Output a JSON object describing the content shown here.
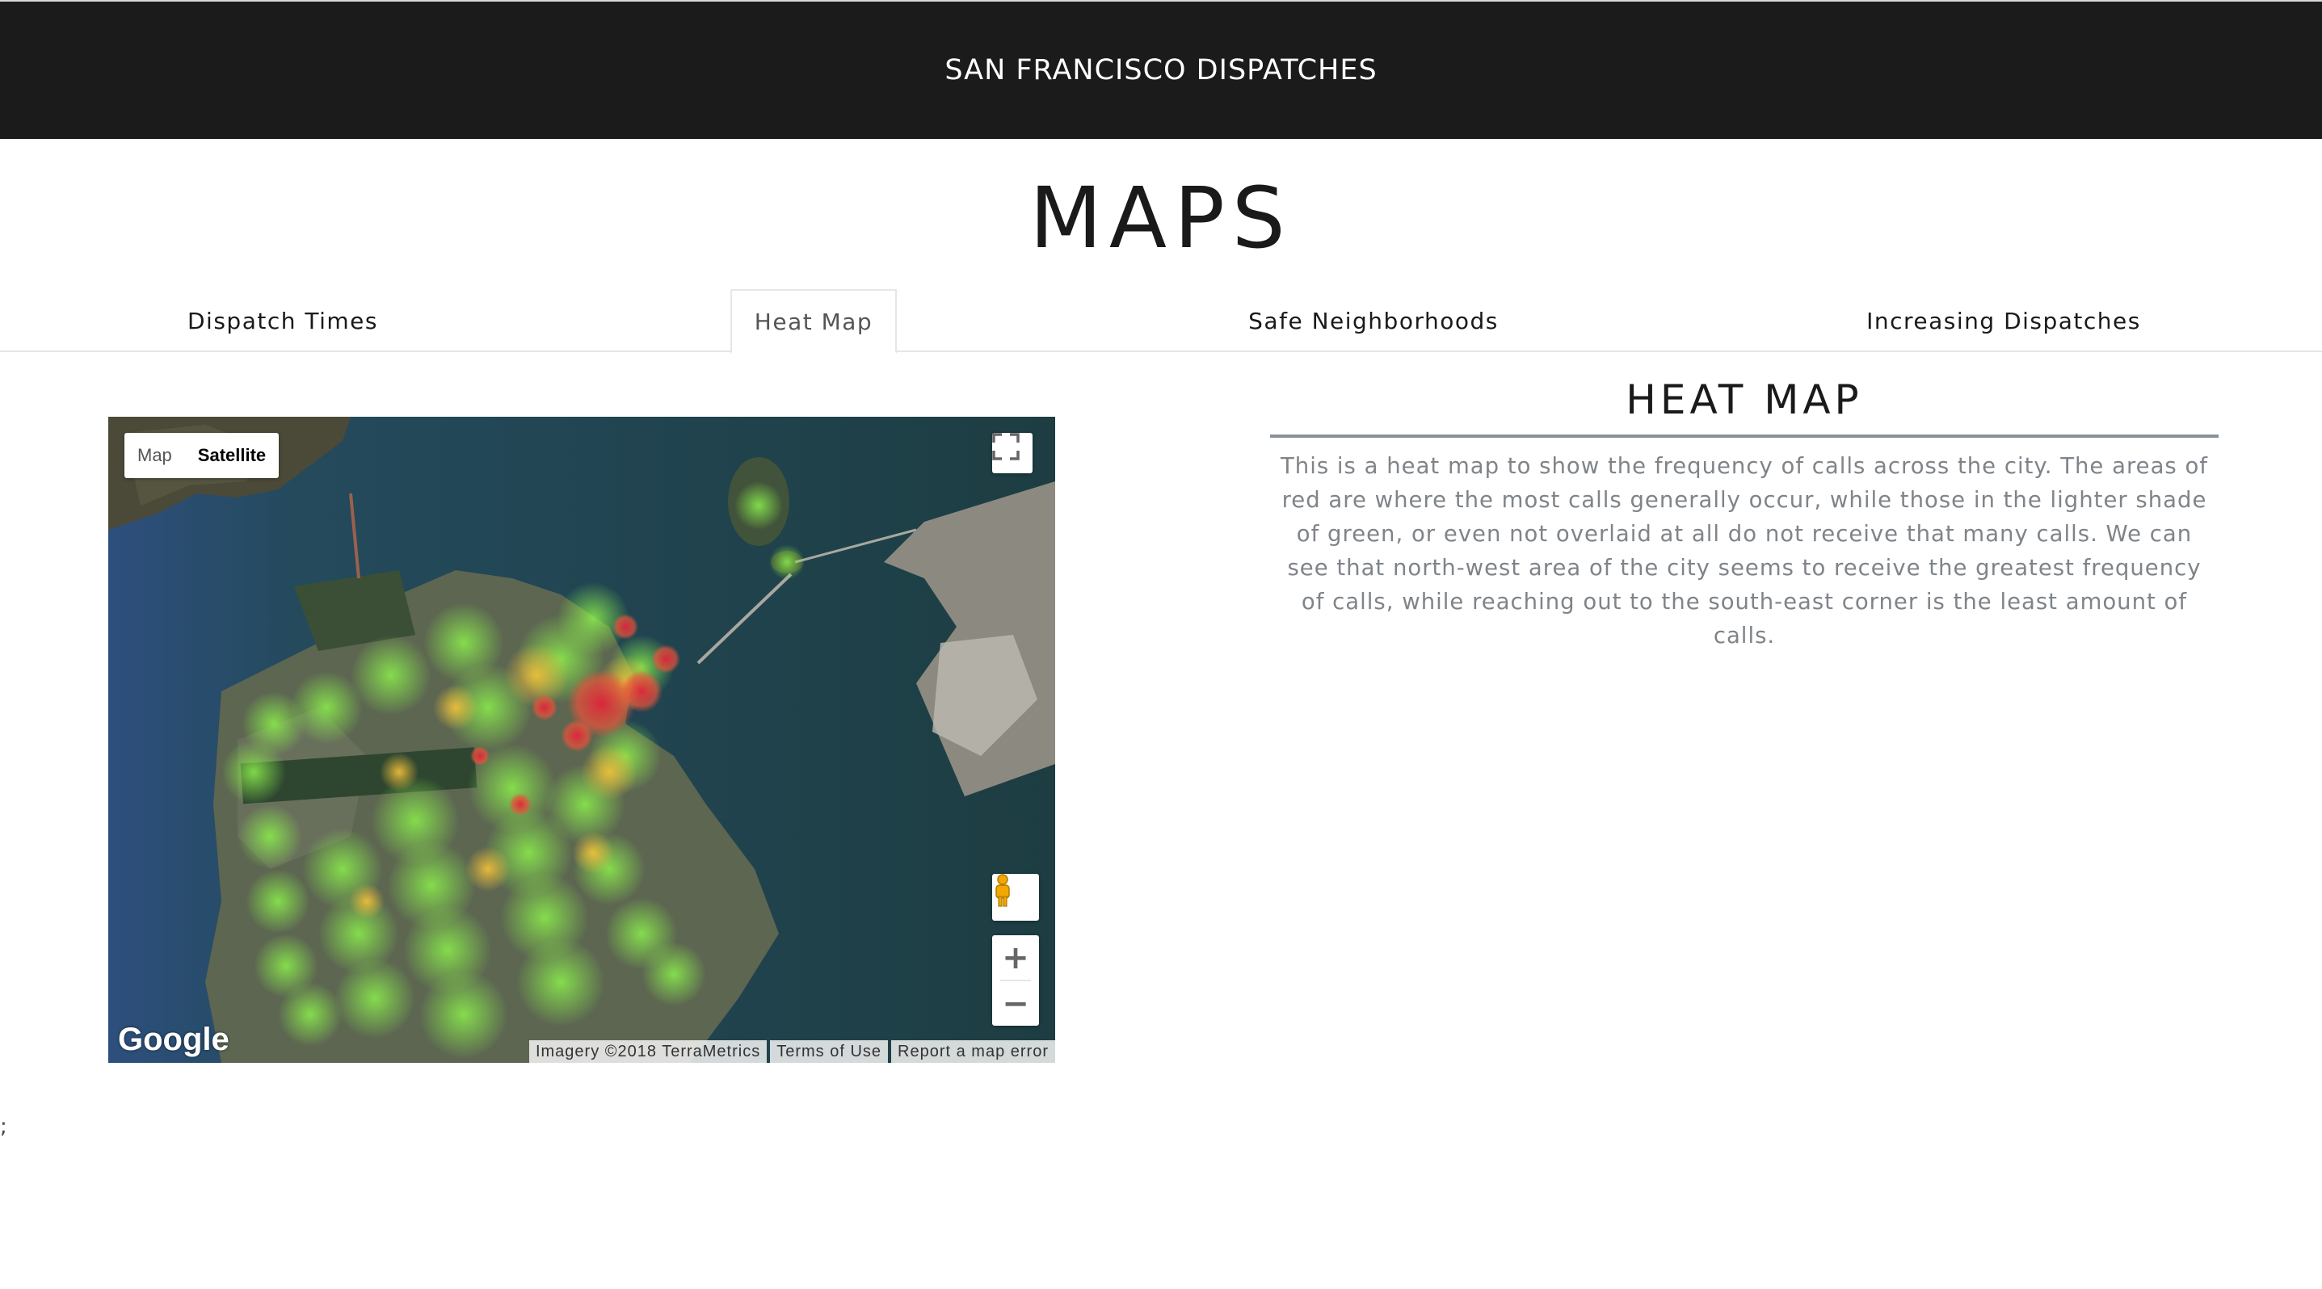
{
  "navbar": {
    "brand": "SAN FRANCISCO DISPATCHES"
  },
  "page": {
    "title": "MAPS"
  },
  "tabs": [
    {
      "label": "Dispatch Times",
      "active": false
    },
    {
      "label": "Heat Map",
      "active": true
    },
    {
      "label": "Safe Neighborhoods",
      "active": false
    },
    {
      "label": "Increasing Dispatches",
      "active": false
    }
  ],
  "map": {
    "type_controls": {
      "map_label": "Map",
      "satellite_label": "Satellite",
      "selected": "Satellite"
    },
    "zoom_in_label": "+",
    "zoom_out_label": "−",
    "logo": "Google",
    "attribution": {
      "imagery": "Imagery ©2018 TerraMetrics",
      "terms": "Terms of Use",
      "report": "Report a map error"
    },
    "icons": [
      "fullscreen-icon",
      "pegman-icon",
      "google-logo"
    ],
    "heat_colors": {
      "low": "#7be04a",
      "mid": "#f2c33a",
      "high": "#e0233a"
    }
  },
  "panel": {
    "title": "HEAT MAP",
    "text": "This is a heat map to show the frequency of calls across the city. The areas of red are where the most calls generally occur, while those in the lighter shade of green, or even not overlaid at all do not receive that many calls. We can see that north-west area of the city seems to receive the greatest frequency of calls, while reaching out to the south-east corner is the least amount of calls."
  },
  "stray_text": ";"
}
